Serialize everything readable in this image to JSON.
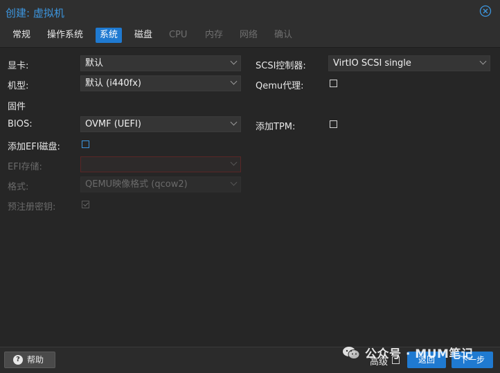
{
  "dialog": {
    "title": "创建: 虚拟机"
  },
  "tabs": [
    {
      "label": "常规",
      "state": "normal"
    },
    {
      "label": "操作系统",
      "state": "normal"
    },
    {
      "label": "系统",
      "state": "active"
    },
    {
      "label": "磁盘",
      "state": "normal"
    },
    {
      "label": "CPU",
      "state": "disabled"
    },
    {
      "label": "内存",
      "state": "disabled"
    },
    {
      "label": "网络",
      "state": "disabled"
    },
    {
      "label": "确认",
      "state": "disabled"
    }
  ],
  "form": {
    "graphics_label": "显卡:",
    "graphics_value": "默认",
    "machine_label": "机型:",
    "machine_value": "默认 (i440fx)",
    "firmware_heading": "固件",
    "bios_label": "BIOS:",
    "bios_value": "OVMF (UEFI)",
    "add_efi_label": "添加EFI磁盘:",
    "add_efi_checked": false,
    "efi_storage_label": "EFI存储:",
    "efi_storage_value": "",
    "format_label": "格式:",
    "format_value": "QEMU映像格式 (qcow2)",
    "pre_enroll_label": "预注册密钥:",
    "pre_enroll_checked": true,
    "scsi_label": "SCSI控制器:",
    "scsi_value": "VirtIO SCSI single",
    "qemu_agent_label": "Qemu代理:",
    "qemu_agent_checked": false,
    "add_tpm_label": "添加TPM:",
    "add_tpm_checked": false
  },
  "footer": {
    "help_label": "帮助",
    "advanced_label": "高级",
    "advanced_checked": false,
    "back_label": "返回",
    "next_label": "下一步"
  },
  "watermark": {
    "text": "公众号 · MUM笔记"
  },
  "colors": {
    "accent": "#1f7ad1",
    "title": "#3d97e0",
    "background": "#262626"
  }
}
